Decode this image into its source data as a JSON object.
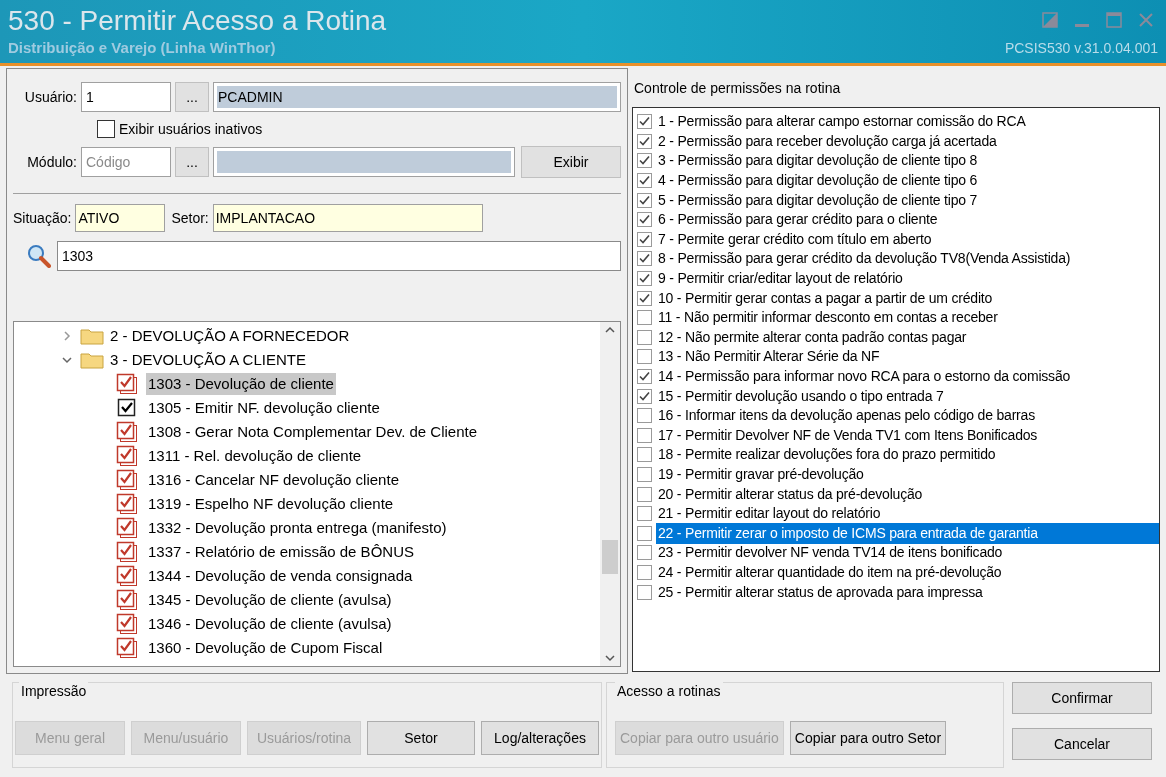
{
  "window": {
    "title": "530 - Permitir Acesso a Rotina",
    "subtitle": "Distribuição e Varejo (Linha WinThor)",
    "version": "PCSIS530  v.31.0.04.001"
  },
  "user": {
    "label": "Usuário:",
    "code": "1",
    "name": "PCADMIN",
    "browse": "..."
  },
  "show_inactive": {
    "label": "Exibir usuários inativos",
    "checked": false
  },
  "module": {
    "label": "Módulo:",
    "placeholder": "Código",
    "browse": "...",
    "show_button": "Exibir"
  },
  "status": {
    "label": "Situação:",
    "value": "ATIVO"
  },
  "sector": {
    "label": "Setor:",
    "value": "IMPLANTACAO"
  },
  "search": {
    "value": "1303"
  },
  "tree": [
    {
      "label": "2 - DEVOLUÇÃO A FORNECEDOR",
      "expanded": false
    },
    {
      "label": "3 - DEVOLUÇÃO A CLIENTE",
      "expanded": true,
      "children": [
        {
          "label": "1303 - Devolução de cliente",
          "kind": "multi",
          "checked": true,
          "selected": true
        },
        {
          "label": "1305 - Emitir NF. devolução cliente",
          "kind": "single",
          "checked": true,
          "selected": false
        },
        {
          "label": "1308 - Gerar Nota Complementar Dev. de Cliente",
          "kind": "multi",
          "checked": true,
          "selected": false
        },
        {
          "label": "1311 - Rel. devolução de cliente",
          "kind": "multi",
          "checked": true,
          "selected": false
        },
        {
          "label": "1316 - Cancelar NF devolução cliente",
          "kind": "multi",
          "checked": true,
          "selected": false
        },
        {
          "label": "1319 - Espelho NF devolução cliente",
          "kind": "multi",
          "checked": true,
          "selected": false
        },
        {
          "label": "1332 - Devolução pronta entrega (manifesto)",
          "kind": "multi",
          "checked": true,
          "selected": false
        },
        {
          "label": "1337 - Relatório de emissão de BÔNUS",
          "kind": "multi",
          "checked": true,
          "selected": false
        },
        {
          "label": "1344 - Devolução de venda consignada",
          "kind": "multi",
          "checked": true,
          "selected": false
        },
        {
          "label": "1345 - Devolução de cliente (avulsa)",
          "kind": "multi",
          "checked": true,
          "selected": false
        },
        {
          "label": "1346 - Devolução de cliente (avulsa)",
          "kind": "multi",
          "checked": true,
          "selected": false
        },
        {
          "label": "1360 - Devolução de Cupom Fiscal",
          "kind": "multi",
          "checked": true,
          "selected": false
        }
      ]
    }
  ],
  "permissions": {
    "title": "Controle de permissões na rotina",
    "items": [
      {
        "label": "1 - Permissão para alterar campo estornar comissão do RCA",
        "checked": true,
        "selected": false
      },
      {
        "label": "2 - Permissão para receber devolução carga já acertada",
        "checked": true,
        "selected": false
      },
      {
        "label": "3 - Permissão para digitar devolução de cliente tipo 8",
        "checked": true,
        "selected": false
      },
      {
        "label": "4 - Permissão para digitar devolução de cliente tipo 6",
        "checked": true,
        "selected": false
      },
      {
        "label": "5 - Permissão para digitar devolução de cliente tipo 7",
        "checked": true,
        "selected": false
      },
      {
        "label": "6 - Permissão para gerar crédito para o cliente",
        "checked": true,
        "selected": false
      },
      {
        "label": "7 - Permite gerar crédito com título em aberto",
        "checked": true,
        "selected": false
      },
      {
        "label": "8 - Permissão para gerar crédito da devolução TV8(Venda Assistida)",
        "checked": true,
        "selected": false
      },
      {
        "label": "9 - Permitir criar/editar layout de relatório",
        "checked": true,
        "selected": false
      },
      {
        "label": "10 - Permitir gerar contas a pagar a partir de um crédito",
        "checked": true,
        "selected": false
      },
      {
        "label": "11 - Não permitir informar desconto em contas a receber",
        "checked": false,
        "selected": false
      },
      {
        "label": "12 - Não permite alterar conta padrão contas pagar",
        "checked": false,
        "selected": false
      },
      {
        "label": "13 - Não Permitir Alterar Série da NF",
        "checked": false,
        "selected": false
      },
      {
        "label": "14 - Permissão para informar novo RCA para o estorno da comissão",
        "checked": true,
        "selected": false
      },
      {
        "label": "15 - Permitir devolução usando o tipo entrada 7",
        "checked": true,
        "selected": false
      },
      {
        "label": "16 - Informar itens da devolução apenas pelo código de barras",
        "checked": false,
        "selected": false
      },
      {
        "label": "17 - Permitir Devolver NF de Venda TV1 com Itens Bonificados",
        "checked": false,
        "selected": false
      },
      {
        "label": "18 - Permite realizar devoluções fora do prazo permitido",
        "checked": false,
        "selected": false
      },
      {
        "label": "19 - Permitir gravar pré-devolução",
        "checked": false,
        "selected": false
      },
      {
        "label": "20 - Permitir alterar status da pré-devolução",
        "checked": false,
        "selected": false
      },
      {
        "label": "21 - Permitir editar layout do relatório",
        "checked": false,
        "selected": false
      },
      {
        "label": "22 - Permitir zerar o imposto de ICMS para entrada de garantia",
        "checked": false,
        "selected": true
      },
      {
        "label": "23 - Permitir devolver NF venda TV14 de itens bonificado",
        "checked": false,
        "selected": false
      },
      {
        "label": "24 - Permitir alterar quantidade do item na pré-devolução",
        "checked": false,
        "selected": false
      },
      {
        "label": "25 - Permitir alterar status de aprovada para impressa",
        "checked": false,
        "selected": false
      }
    ]
  },
  "print_group": {
    "title": "Impressão",
    "buttons": [
      {
        "label": "Menu geral",
        "disabled": true
      },
      {
        "label": "Menu/usuário",
        "disabled": true
      },
      {
        "label": "Usuários/rotina",
        "disabled": true
      },
      {
        "label": "Setor",
        "disabled": false
      },
      {
        "label": "Log/alterações",
        "disabled": false
      }
    ]
  },
  "access_group": {
    "title": "Acesso a rotinas",
    "buttons": [
      {
        "label": "Copiar para outro usuário",
        "disabled": true
      },
      {
        "label": "Copiar para outro Setor",
        "disabled": false
      }
    ]
  },
  "actions": [
    {
      "label": "Confirmar"
    },
    {
      "label": "Cancelar"
    }
  ]
}
